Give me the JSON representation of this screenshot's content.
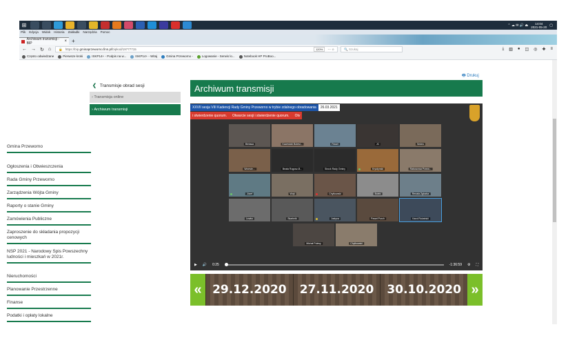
{
  "taskbar": {
    "time": "14:04",
    "date": "2021-05-20"
  },
  "browser": {
    "menu": [
      "Plik",
      "Edycja",
      "Widok",
      "Historia",
      "Zakładki",
      "Narzędzia",
      "Pomoc"
    ],
    "tab_title": "Archiwum transmisji - BIP",
    "tab_close": "×",
    "newtab": "+",
    "url_prefix": "https://bip.",
    "url_domain": "gminaprzeworno.finn.pl",
    "url_path": "/bipkod/19777715",
    "zoom": "120%",
    "search_placeholder": "Szukaj",
    "bookmarks": [
      "Często odwiedzane",
      "Pierwsze kroki",
      "ISKP14+ - Podpis na w...",
      "ISKP14+ - Witaj",
      "Gmina Przeworno -",
      "Logowanie - Serwis lo...",
      "Notebook HP ProBoo..."
    ]
  },
  "page": {
    "print_label": "Drukuj",
    "title": "Archiwum transmisji",
    "sidebar": {
      "header": "Transmisje obrad sesji",
      "sub_items": [
        "Transmisja online",
        "Archiwum transmisji"
      ],
      "items": [
        "Gmina Przeworno",
        "Ogłoszenia i Obwieszczenia",
        "Rada Gminy Przeworno",
        "Zarządzenia Wójta Gminy",
        "Raporty o stanie Gminy",
        "Zamówienia Publiczne",
        "Zaproszenie do składania propozycji cenowych",
        "NSP 2021 - Narodowy Spis Powszechny ludności i mieszkań w 2021r.",
        "Nieruchomości",
        "Planowanie Przestrzenne",
        "Finanse",
        "Podatki i opłaty lokalne"
      ]
    },
    "video": {
      "session_title": "XXVII sesja VIII Kadencji Rady Gminy Przeworno w trybie zdalnego obradowania",
      "session_date": "26.03.2021",
      "subtitles": [
        "i stwierdzenie quorum.",
        "Otwarcie sesji i stwierdzenie quorum.",
        "Otv"
      ],
      "participants": [
        "Bielawa",
        "Kacewicki Bolesł...",
        "Paweł",
        "JC",
        "Sedeo",
        "Wrzesie...",
        "Beata Rogosz-B...",
        "Sirock Rady Gminy",
        "Krystynski",
        "Ratuszowa Przew...",
        "Józef",
        "Wojt",
        "Chylkowski",
        "Bolek",
        "Renata Zgłozka",
        "Lewko",
        "Skarbnik",
        "Justyna",
        "Paweł Porch",
        "Karol Rożański",
        "Michał Polesy",
        "Chylkowski"
      ],
      "elapsed": "0:25",
      "remaining": "-1:36:59"
    },
    "carousel": {
      "prev": "«",
      "next": "»",
      "dates": [
        "29.12.2020",
        "27.11.2020",
        "30.10.2020"
      ]
    }
  },
  "colors": {
    "accent": "#177a4d",
    "arrow": "#7bbf2a",
    "sub_bar": "#d73a2f"
  }
}
